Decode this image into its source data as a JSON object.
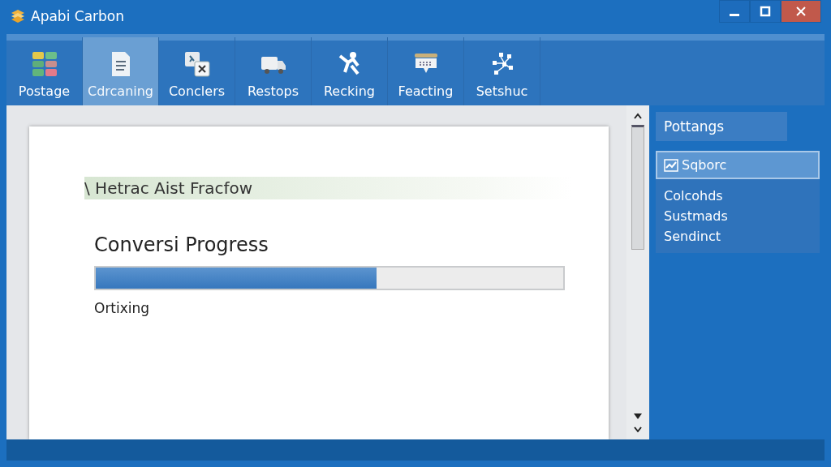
{
  "window": {
    "title": "Apabi Carbon"
  },
  "toolbar": [
    {
      "label": "Postage",
      "selected": false
    },
    {
      "label": "Cdrcaning",
      "selected": true
    },
    {
      "label": "Conclers",
      "selected": false
    },
    {
      "label": "Restops",
      "selected": false
    },
    {
      "label": "Recking",
      "selected": false
    },
    {
      "label": "Feacting",
      "selected": false
    },
    {
      "label": "Setshuc",
      "selected": false
    }
  ],
  "document": {
    "heading": "\\ Hetrac Aist Fracfow",
    "progress": {
      "title": "Conversi Progress",
      "level": 0.6,
      "status": "Ortixing"
    }
  },
  "panel": {
    "header": "Pottangs",
    "items": [
      {
        "label": "Sqborc",
        "selected": true
      },
      {
        "label": "Colcohds",
        "selected": false
      },
      {
        "label": "Sustmads",
        "selected": false
      },
      {
        "label": "Sendinct",
        "selected": false
      }
    ]
  }
}
